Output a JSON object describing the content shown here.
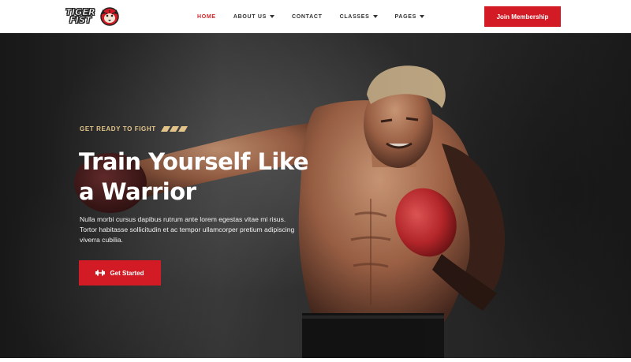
{
  "brand": {
    "logo_line1": "TIGER",
    "logo_line2": "FIST"
  },
  "nav": {
    "items": [
      {
        "label": "HOME",
        "active": true,
        "dropdown": false
      },
      {
        "label": "ABOUT US",
        "active": false,
        "dropdown": true
      },
      {
        "label": "CONTACT",
        "active": false,
        "dropdown": false
      },
      {
        "label": "CLASSES",
        "active": false,
        "dropdown": true
      },
      {
        "label": "PAGES",
        "active": false,
        "dropdown": true
      }
    ],
    "cta_label": "Join Membership"
  },
  "hero": {
    "eyebrow": "GET READY TO FIGHT",
    "title_line1": "Train Yourself Like",
    "title_line2": "a Warrior",
    "description": "Nulla morbi cursus dapibus rutrum ante lorem egestas vitae mi risus. Tortor habitasse sollicitudin et ac tempor ullamcorper pretium adipiscing viverra cubilia.",
    "cta_label": "Get Started",
    "cta_icon": "dumbbell-icon"
  },
  "colors": {
    "accent": "#d21b24",
    "eyebrow": "#e2c48a",
    "nav_active": "#d3262b"
  }
}
